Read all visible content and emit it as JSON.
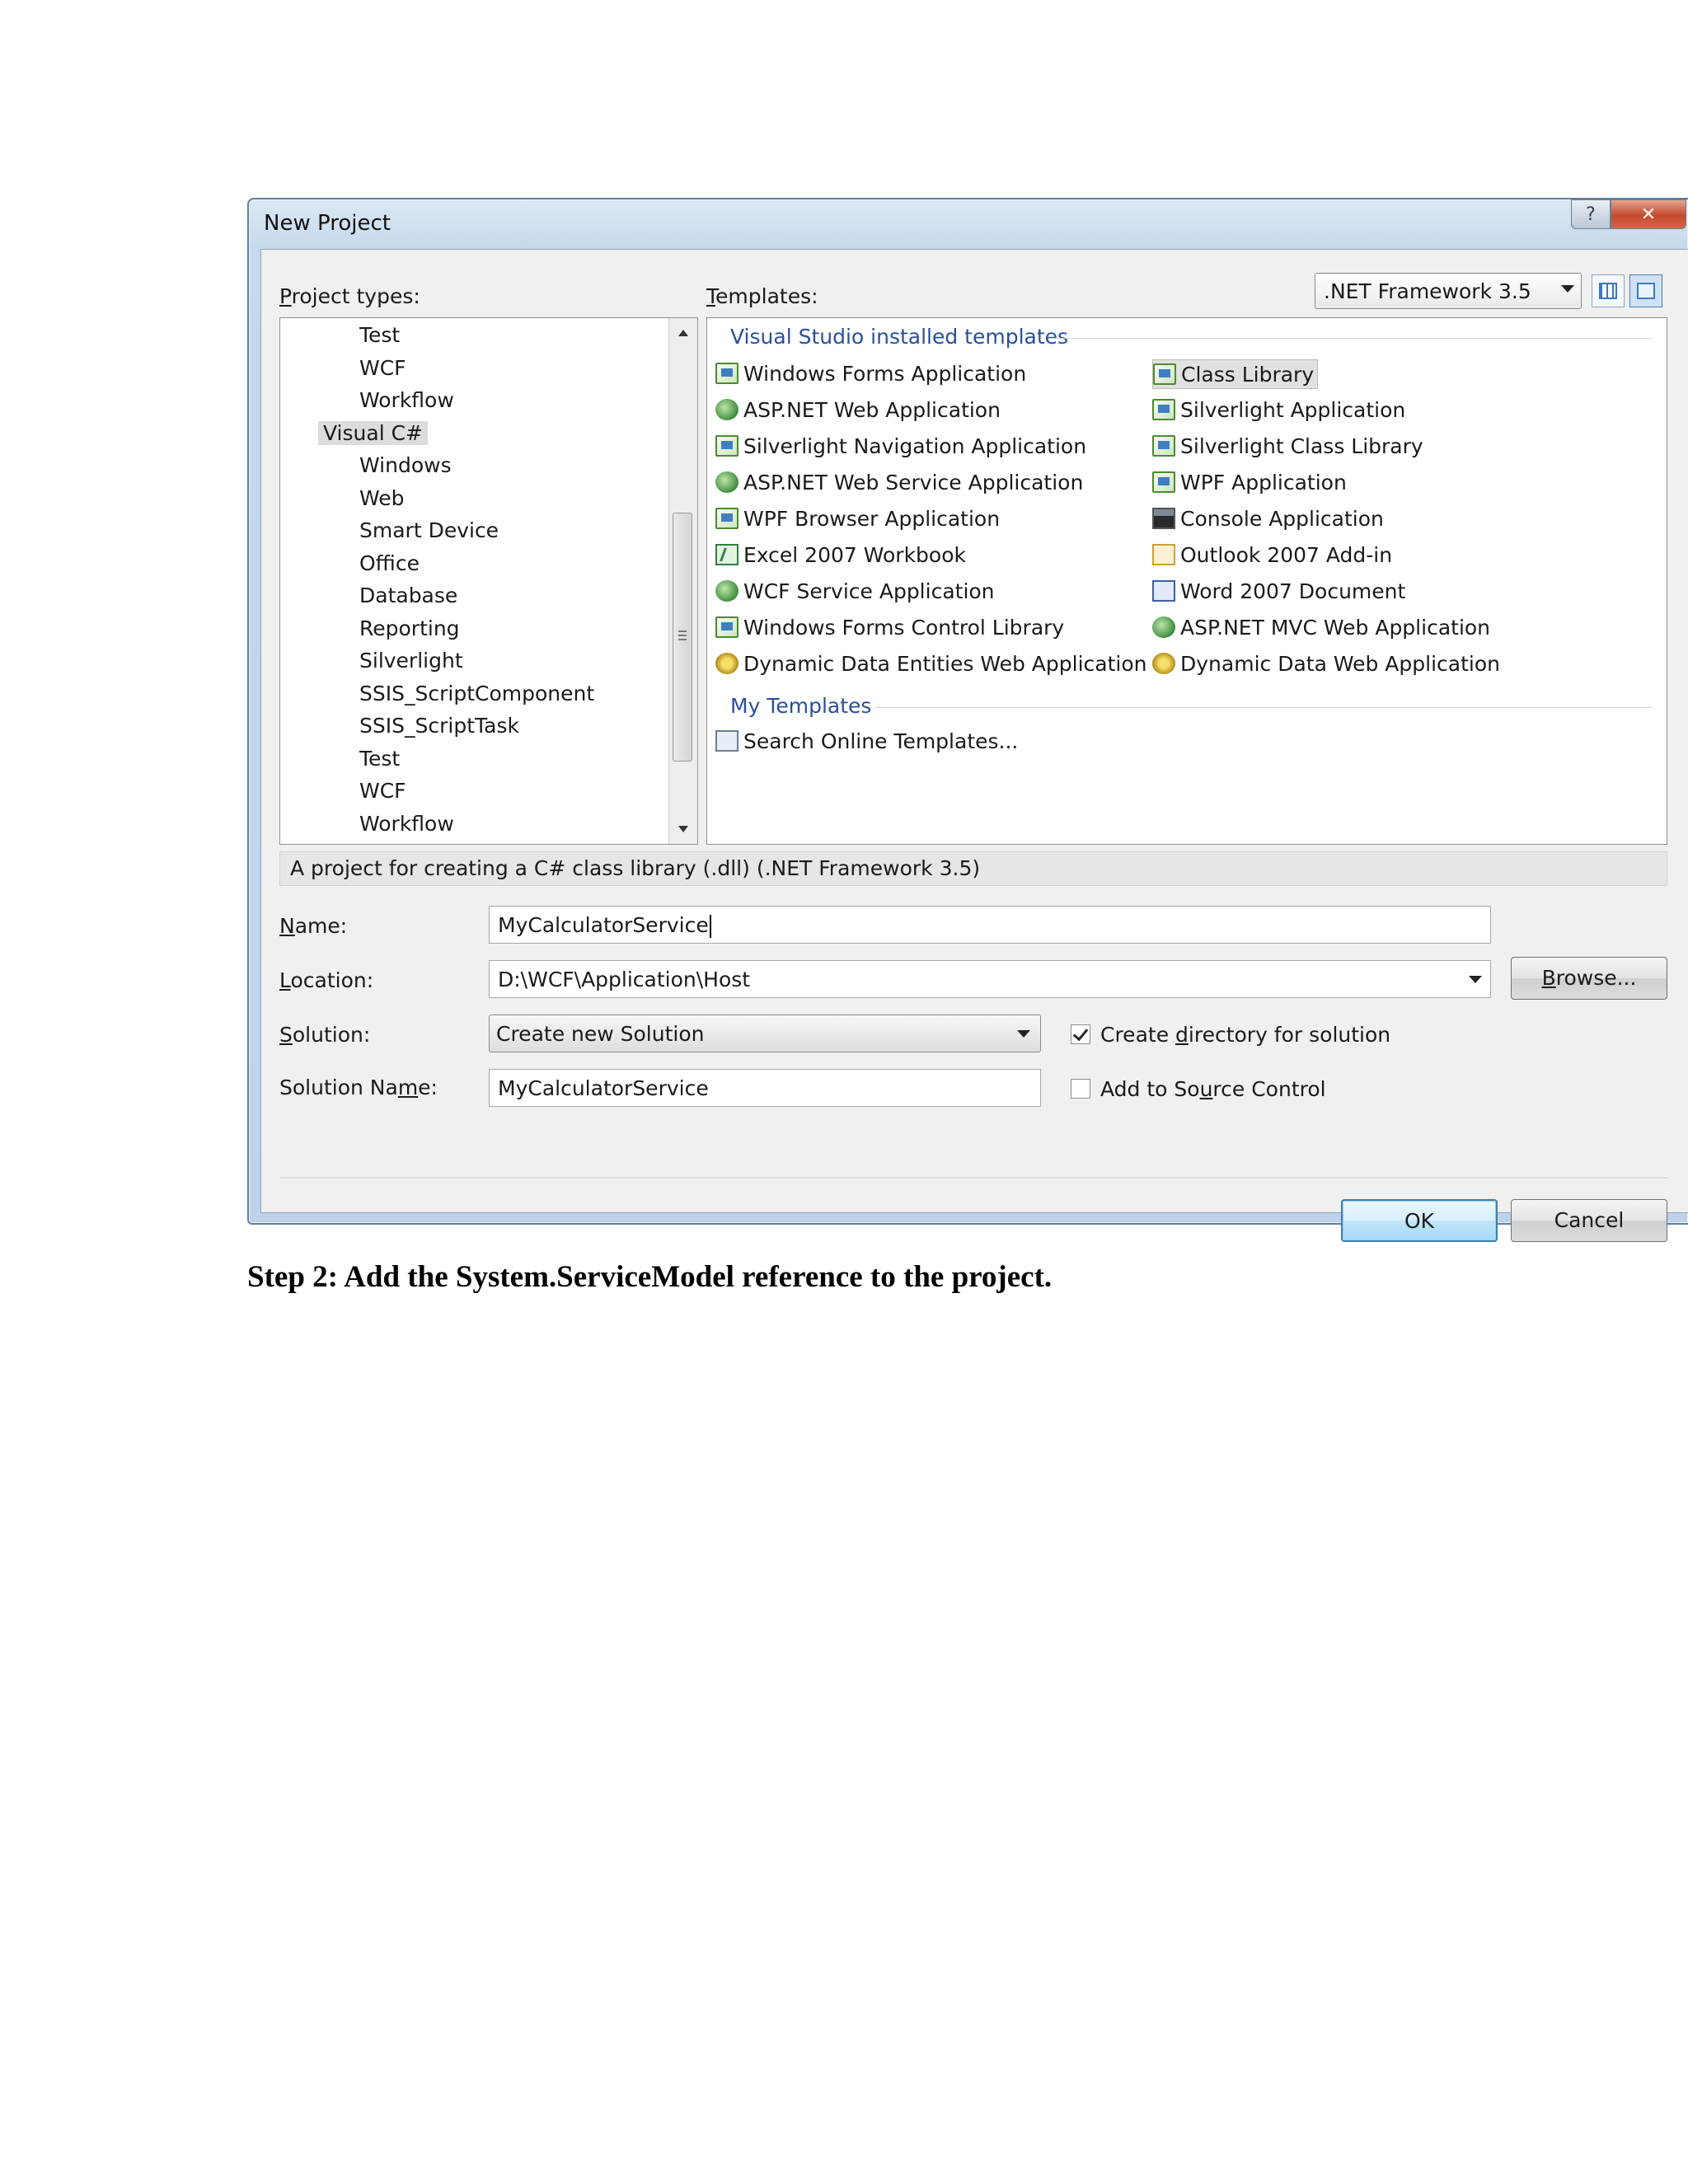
{
  "dialog": {
    "title": "New Project",
    "help_label": "?",
    "close_label": "✕"
  },
  "project_types": {
    "label_prefix": "",
    "label_underline": "P",
    "label_rest": "roject types:",
    "items": [
      "Test",
      "WCF",
      "Workflow",
      "Visual C#",
      "Windows",
      "Web",
      "Smart Device",
      "Office",
      "Database",
      "Reporting",
      "Silverlight",
      "SSIS_ScriptComponent",
      "SSIS_ScriptTask",
      "Test",
      "WCF",
      "Workflow"
    ],
    "selected_index": 3
  },
  "templates": {
    "label_underline": "T",
    "label_rest": "emplates:",
    "framework": ".NET Framework 3.5",
    "installed_title": "Visual Studio installed templates",
    "left_column": [
      {
        "label": "Windows Forms Application",
        "icon": "cs"
      },
      {
        "label": "ASP.NET Web Application",
        "icon": "web"
      },
      {
        "label": "Silverlight Navigation Application",
        "icon": "cs"
      },
      {
        "label": "ASP.NET Web Service Application",
        "icon": "web"
      },
      {
        "label": "WPF Browser Application",
        "icon": "cs"
      },
      {
        "label": "Excel 2007 Workbook",
        "icon": "xl"
      },
      {
        "label": "WCF Service Application",
        "icon": "web"
      },
      {
        "label": "Windows Forms Control Library",
        "icon": "cs"
      },
      {
        "label": "Dynamic Data Entities Web Application",
        "icon": "gear"
      }
    ],
    "right_column": [
      {
        "label": "Class Library",
        "icon": "cs"
      },
      {
        "label": "Silverlight Application",
        "icon": "cs"
      },
      {
        "label": "Silverlight Class Library",
        "icon": "cs"
      },
      {
        "label": "WPF Application",
        "icon": "cs"
      },
      {
        "label": "Console Application",
        "icon": "con"
      },
      {
        "label": "Outlook 2007 Add-in",
        "icon": "ol"
      },
      {
        "label": "Word 2007 Document",
        "icon": "wd"
      },
      {
        "label": "ASP.NET MVC Web Application",
        "icon": "web"
      },
      {
        "label": "Dynamic Data Web Application",
        "icon": "gear"
      }
    ],
    "my_templates_title": "My Templates",
    "search_online": "Search Online Templates..."
  },
  "description": "A project for creating a C# class library (.dll) (.NET Framework 3.5)",
  "form": {
    "name_label_u": "N",
    "name_label_rest": "ame:",
    "name_value": "MyCalculatorService",
    "location_label_u": "L",
    "location_label_rest": "ocation:",
    "location_value": "D:\\WCF\\Application\\Host",
    "browse_u": "B",
    "browse_rest": "rowse...",
    "solution_label_u": "S",
    "solution_label_rest": "olution:",
    "solution_value": "Create new Solution",
    "solution_name_label_a": "Solution Na",
    "solution_name_label_u": "m",
    "solution_name_label_rest": "e:",
    "solution_name_value": "MyCalculatorService",
    "create_dir_a": "Create ",
    "create_dir_u": "d",
    "create_dir_rest": "irectory for solution",
    "create_dir_checked": true,
    "source_control_a": "Add to So",
    "source_control_u": "u",
    "source_control_rest": "rce Control",
    "source_control_checked": false
  },
  "buttons": {
    "ok": "OK",
    "cancel": "Cancel"
  },
  "caption": "Step 2: Add the System.ServiceModel reference to the project."
}
